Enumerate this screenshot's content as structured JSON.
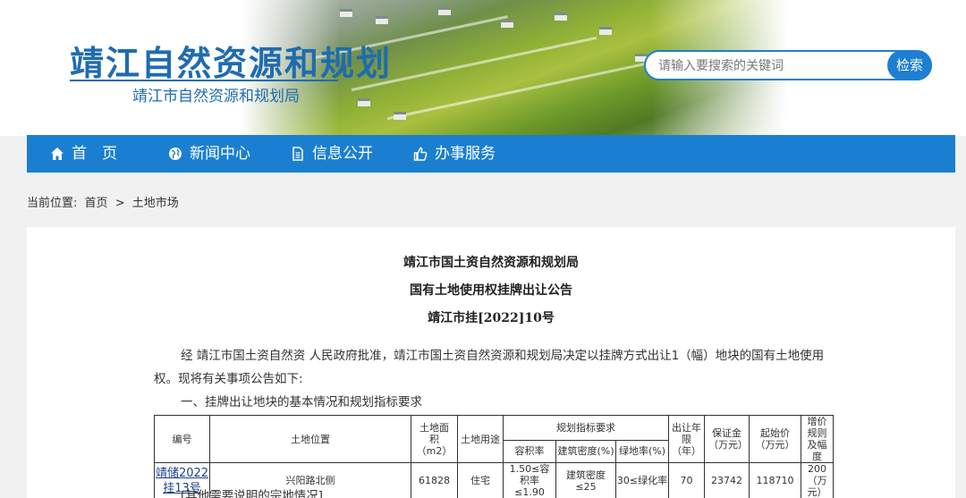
{
  "header": {
    "site_title": "靖江自然资源和规划",
    "site_subtitle": "靖江市自然资源和规划局",
    "search_placeholder": "请输入要搜索的关键词",
    "search_button": "检索"
  },
  "nav": {
    "items": [
      {
        "label": "首　页",
        "icon": "home-icon"
      },
      {
        "label": "新闻中心",
        "icon": "globe-icon"
      },
      {
        "label": "信息公开",
        "icon": "document-icon"
      },
      {
        "label": "办事服务",
        "icon": "thumbs-up-icon"
      }
    ]
  },
  "breadcrumb": {
    "prefix": "当前位置:",
    "home": "首页",
    "separator": ">",
    "current": "土地市场"
  },
  "article": {
    "title1": "靖江市国土资自然资源和规划局",
    "title2": "国有土地使用权挂牌出让公告",
    "title3": "靖江市挂[2022]10号",
    "para1_line1": "经 靖江市国土资自然资 人民政府批准，靖江市国土资自然资源和规划局决定以挂牌方式出让1（幅）地块的国有土地使用",
    "para1_line2": "权。现将有关事项公告如下:",
    "section1": "一、挂牌出让地块的基本情况和规划指标要求",
    "footer_note": "[其他需要说明的宗地情况]"
  },
  "table": {
    "headers": {
      "code": "编号",
      "location": "土地位置",
      "area": "土地面积（m2）",
      "usage": "土地用途",
      "planning": "规划指标要求",
      "far": "容积率",
      "density": "建筑密度(%)",
      "green": "绿地率(%)",
      "term": "出让年限（年）",
      "deposit": "保证金（万元）",
      "start_price": "起始价（万元）",
      "increment": "增价规则及幅度"
    },
    "row": {
      "code_line1": "靖储2022",
      "code_line2": "挂13号",
      "location": "兴阳路北侧",
      "area": "61828",
      "usage": "住宅",
      "far": "1.50≤容积率≤1.90",
      "density": "建筑密度≤25",
      "green": "30≤绿化率",
      "term": "70",
      "deposit": "23742",
      "start_price": "118710",
      "increment": "200（万元）"
    }
  }
}
